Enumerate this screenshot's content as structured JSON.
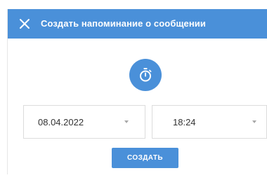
{
  "dialog": {
    "title": "Создать напоминание о сообщении",
    "close_icon": "close-icon",
    "timer_icon": "stopwatch-icon"
  },
  "reminder": {
    "date_value": "08.04.2022",
    "time_value": "18:24"
  },
  "actions": {
    "create_label": "СОЗДАТЬ"
  },
  "colors": {
    "accent": "#4a90d9",
    "header_text": "#ffffff",
    "field_border": "#dcdcdc",
    "caret": "#a8a8a8"
  }
}
